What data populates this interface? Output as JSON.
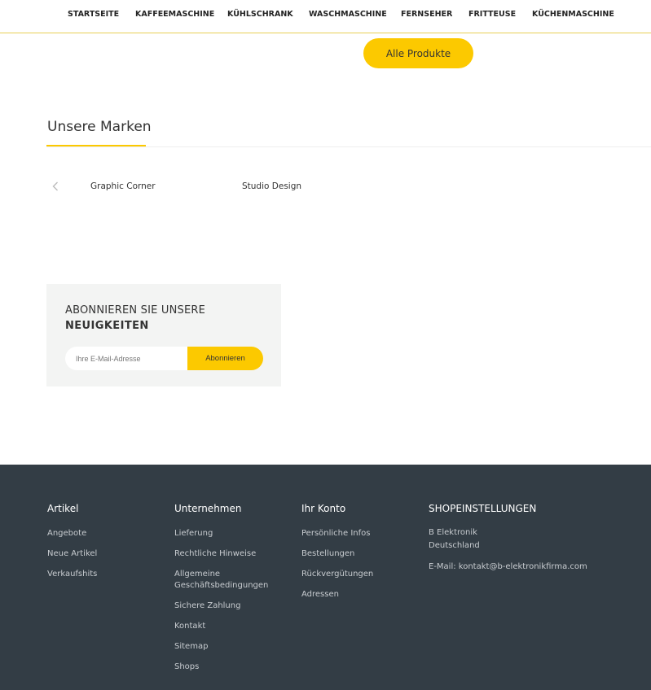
{
  "nav": {
    "items": [
      {
        "label": "STARTSEITE"
      },
      {
        "label": "KAFFEEMASCHINE"
      },
      {
        "label": "KÜHLSCHRANK"
      },
      {
        "label": "WASCHMASCHINE"
      },
      {
        "label": "FERNSEHER"
      },
      {
        "label": "FRITTEUSE"
      },
      {
        "label": "KÜCHENMASCHINE"
      }
    ]
  },
  "products": {
    "all_label": "Alle Produkte"
  },
  "brands": {
    "title": "Unsere Marken",
    "prev_icon": "chevron-left-icon",
    "items": [
      "Graphic Corner",
      "Studio Design"
    ]
  },
  "newsletter": {
    "title_line1": "ABONNIEREN SIE UNSERE",
    "title_line2": "NEUIGKEITEN",
    "email_placeholder": "Ihre E-Mail-Adresse",
    "subscribe_label": "Abonnieren"
  },
  "footer": {
    "columns": [
      {
        "title": "Artikel",
        "links": [
          "Angebote",
          "Neue Artikel",
          "Verkaufshits"
        ]
      },
      {
        "title": "Unternehmen",
        "links": [
          "Lieferung",
          "Rechtliche Hinweise",
          "Allgemeine\nGeschäftsbedingungen",
          "Sichere Zahlung",
          "Kontakt",
          "Sitemap",
          "Shops"
        ]
      },
      {
        "title": "Ihr Konto",
        "links": [
          "Persönliche Infos",
          "Bestellungen",
          "Rückvergütungen",
          "Adressen"
        ]
      }
    ],
    "shop": {
      "title": "SHOPEINSTELLUNGEN",
      "name": "B Elektronik",
      "country": "Deutschland",
      "email": "E-Mail: kontakt@b-elektronikfirma.com"
    }
  },
  "colors": {
    "accent": "#fcc900",
    "footer_bg": "#333d45",
    "newsletter_bg": "#f3f4f3"
  }
}
